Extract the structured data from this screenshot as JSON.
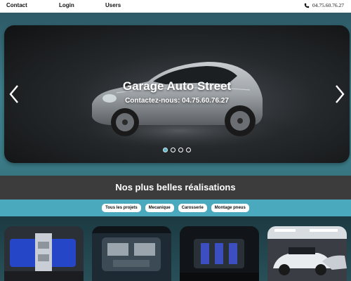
{
  "nav": {
    "links": [
      "Contact",
      "Login",
      "Users"
    ],
    "phone": "04.75.60.76.27",
    "phone_icon": "phone-icon"
  },
  "carousel": {
    "title": "Garage Auto Street",
    "subtitle": "Contactez-nous: 04.75.60.76.27",
    "slide_count": 4,
    "active_slide": 1,
    "prev_icon": "chevron-left-icon",
    "next_icon": "chevron-right-icon"
  },
  "section": {
    "title": "Nos plus belles réalisations"
  },
  "filters": [
    "Tous les projets",
    "Mecanique",
    "Carosserie",
    "Montage pneus"
  ],
  "gallery": {
    "items": [
      "engine-photo",
      "engine-bay-photo",
      "engine-detail-photo",
      "garage-cars-photo"
    ]
  },
  "colors": {
    "accent": "#4aa9bd",
    "section_band": "#3c3c3c",
    "active_dot": "#5fb4c6"
  }
}
